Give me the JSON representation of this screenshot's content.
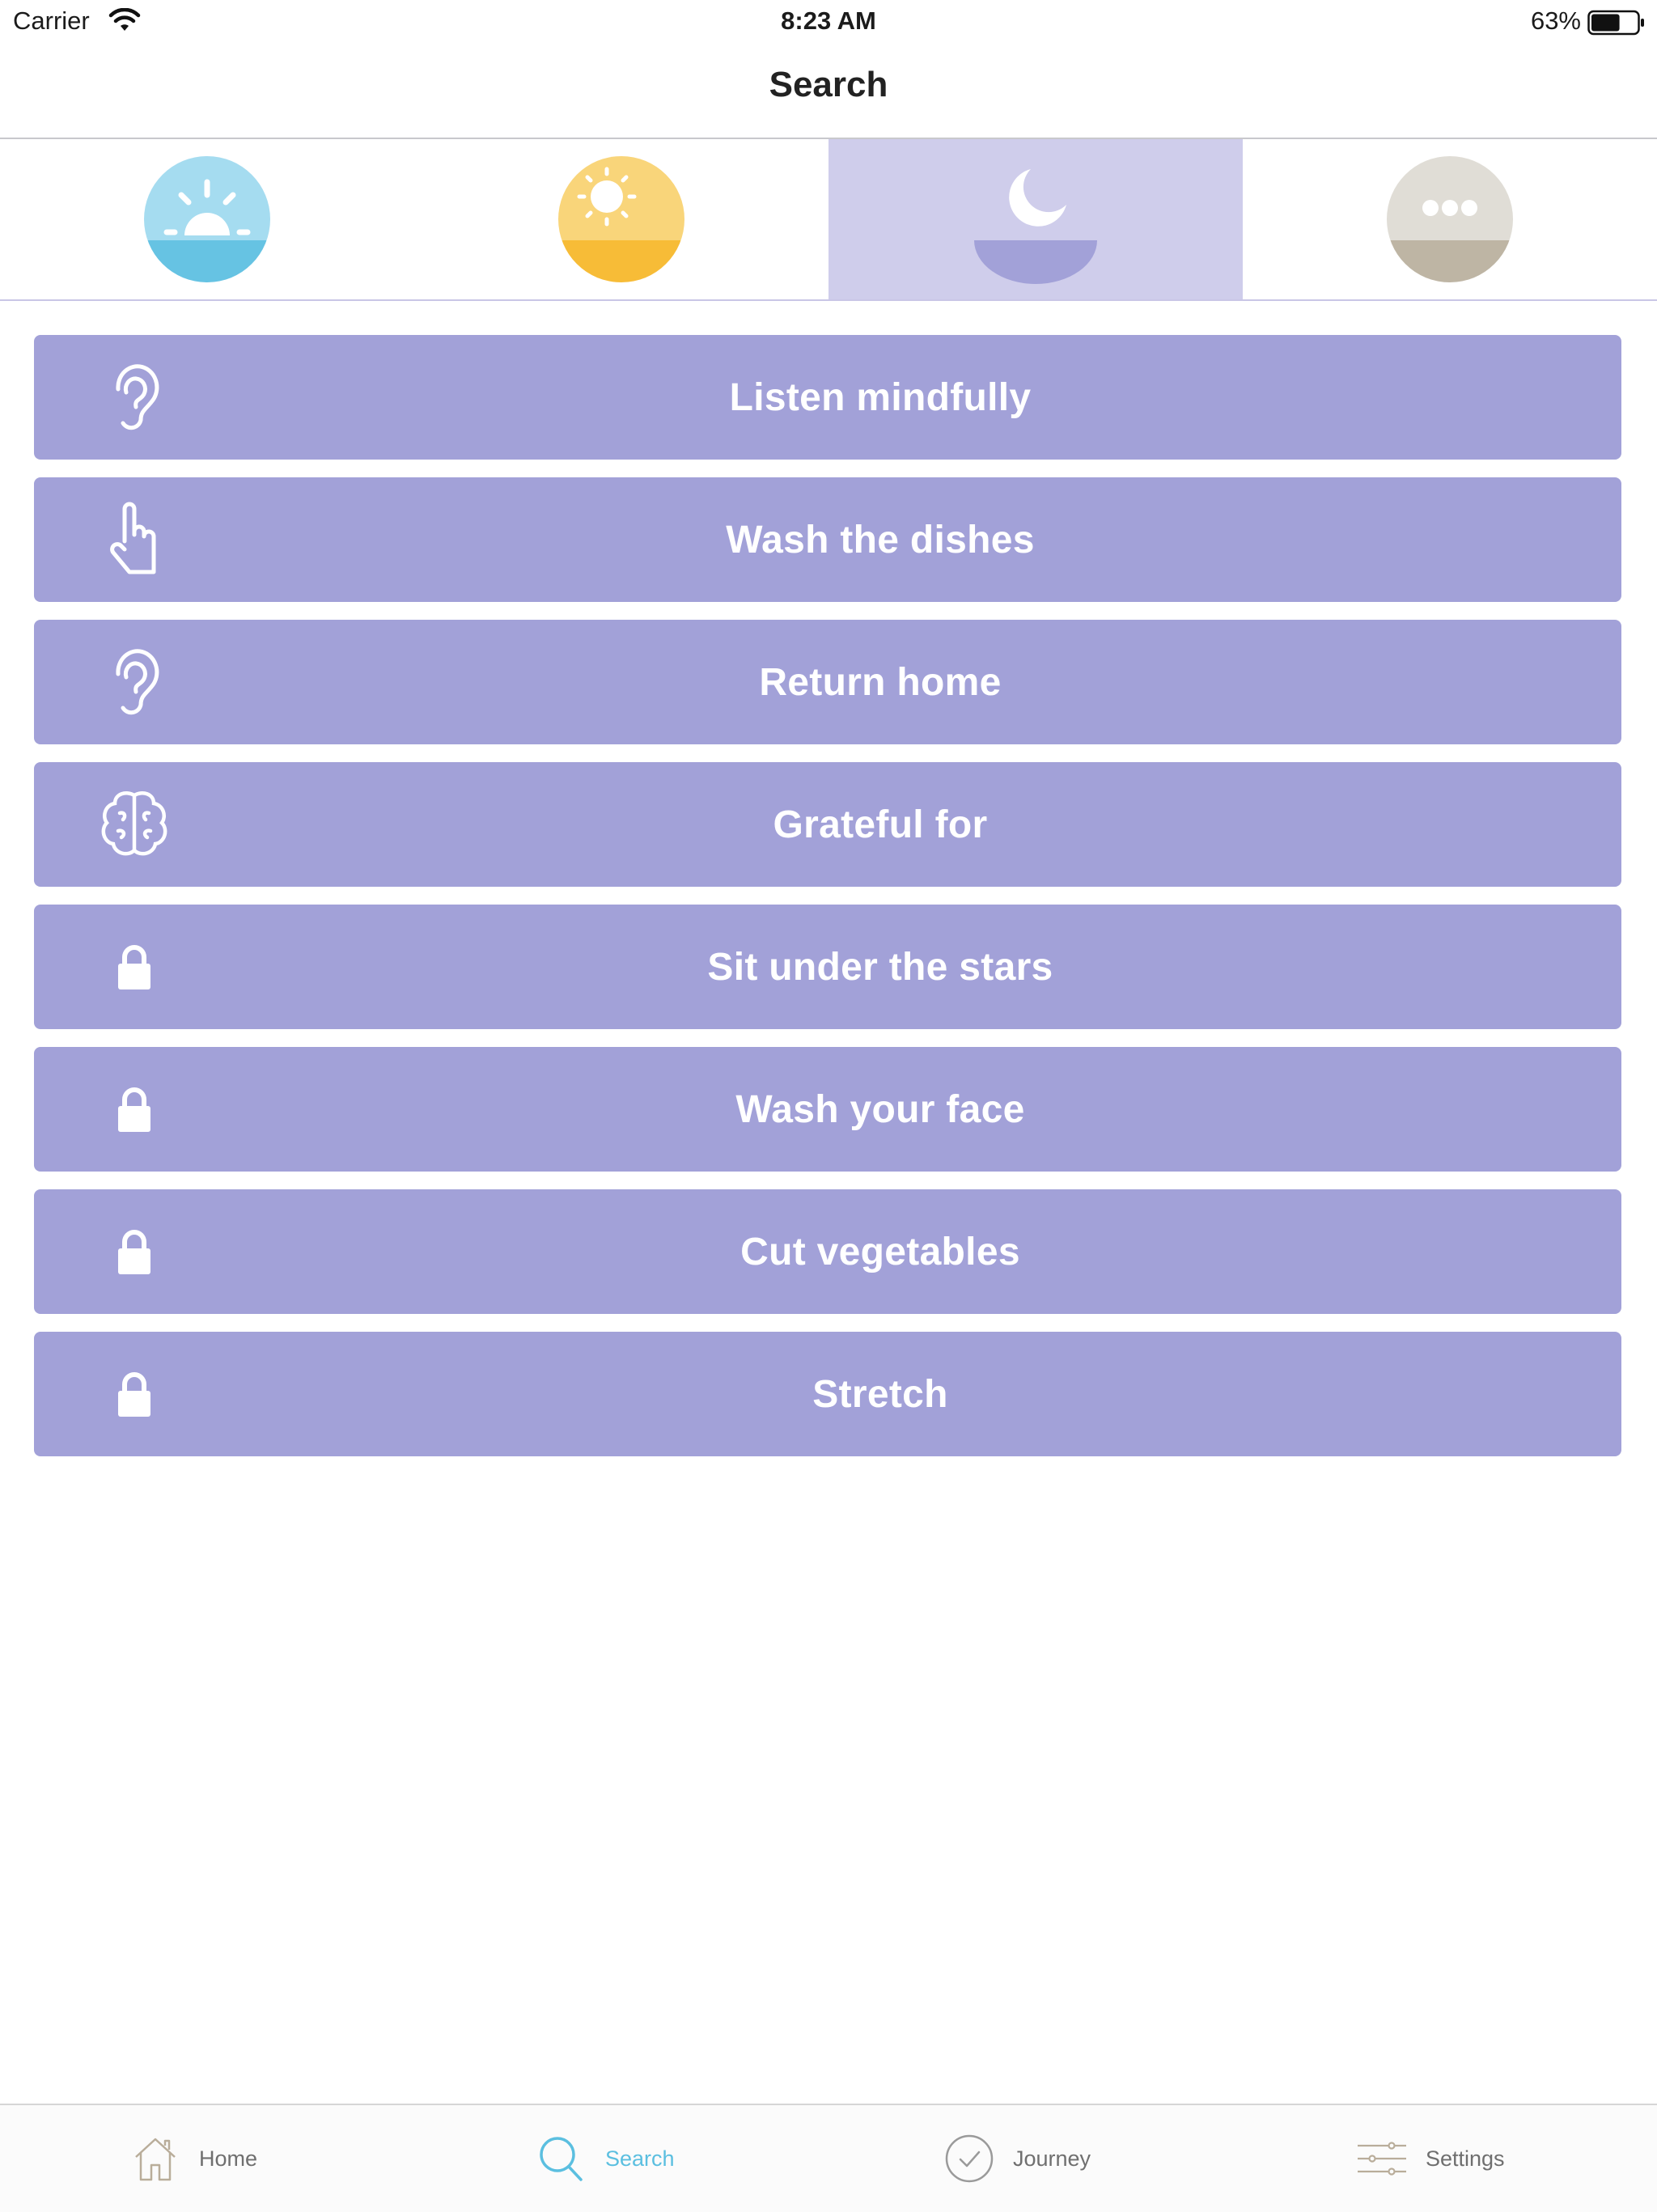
{
  "status_bar": {
    "carrier": "Carrier",
    "time": "8:23 AM",
    "battery": "63%",
    "battery_level": 0.63
  },
  "nav": {
    "title": "Search"
  },
  "segments": [
    {
      "name": "sunrise",
      "icon": "sunrise-icon",
      "selected": false,
      "colors": {
        "top": "#a5dcf0",
        "bottom": "#66c3e3"
      }
    },
    {
      "name": "day",
      "icon": "sun-icon",
      "selected": false,
      "colors": {
        "top": "#f9d57a",
        "bottom": "#f7bc37"
      }
    },
    {
      "name": "night",
      "icon": "moon-icon",
      "selected": true,
      "colors": {
        "top": "#cfcdeb",
        "bottom": "#a2a1d8"
      }
    },
    {
      "name": "other",
      "icon": "more-icon",
      "selected": false,
      "colors": {
        "top": "#e0ddd6",
        "bottom": "#beb5a4"
      }
    }
  ],
  "list": {
    "color": "#a2a1d8",
    "items": [
      {
        "label": "Listen mindfully",
        "icon": "ear-icon"
      },
      {
        "label": "Wash the dishes",
        "icon": "hand-pointer-icon"
      },
      {
        "label": "Return home",
        "icon": "ear-icon"
      },
      {
        "label": "Grateful for",
        "icon": "brain-icon"
      },
      {
        "label": "Sit under the stars",
        "icon": "lock-icon"
      },
      {
        "label": "Wash your face",
        "icon": "lock-icon"
      },
      {
        "label": "Cut vegetables",
        "icon": "lock-icon"
      },
      {
        "label": "Stretch",
        "icon": "lock-icon"
      }
    ]
  },
  "tabs": [
    {
      "label": "Home",
      "icon": "home-icon",
      "active": false
    },
    {
      "label": "Search",
      "icon": "search-icon",
      "active": true
    },
    {
      "label": "Journey",
      "icon": "check-circle-icon",
      "active": false
    },
    {
      "label": "Settings",
      "icon": "sliders-icon",
      "active": false
    }
  ],
  "colors": {
    "accent": "#5bbfe0",
    "inactive_tab": "#6f6f6f"
  }
}
